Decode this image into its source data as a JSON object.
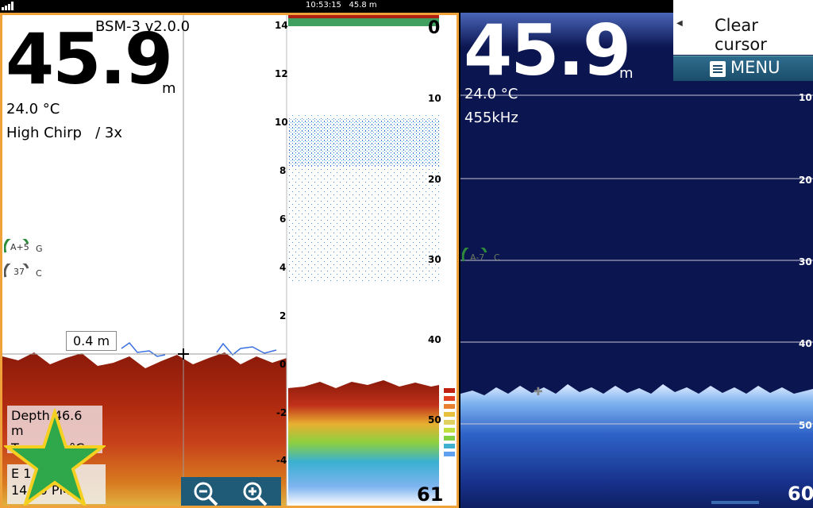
{
  "status_bar": {
    "time": "10:53:15",
    "depth": "45.8 m"
  },
  "left": {
    "title": "BSM-3 v2.0.0",
    "depth_value": "45.9",
    "depth_unit": "m",
    "temperature": "24.0 °C",
    "mode": "High Chirp",
    "zoom_level": "/ 3x",
    "gain_auto": "A+5",
    "gain_label": "G",
    "contrast_value": "37",
    "contrast_label": "C",
    "cursor_depth_label": "0.4 m",
    "info_box": {
      "depth_line": "Depth 46.6 m",
      "temp_line": "Temp 24 °C",
      "coord_line": "E 1 72'",
      "time_line": "14 , 0 PM"
    },
    "zoom_scale": [
      "14",
      "12",
      "10",
      "8",
      "6",
      "4",
      "2",
      "0",
      "-2",
      "-4"
    ],
    "depth_scale": [
      "0",
      "10",
      "20",
      "30",
      "40",
      "50",
      "61"
    ]
  },
  "right": {
    "depth_value": "45.9",
    "depth_unit": "m",
    "temperature": "24.0 °C",
    "frequency": "455kHz",
    "gain_auto": "A-7",
    "gain_label": "C",
    "depth_scale": [
      "10",
      "20",
      "30",
      "40",
      "50",
      "60"
    ]
  },
  "popup": {
    "clear_cursor": "Clear cursor",
    "menu": "MENU"
  },
  "icons": [
    "signal-icon",
    "zoom-out-icon",
    "zoom-in-icon",
    "menu-icon",
    "waypoint-star-icon",
    "cursor-cross-icon"
  ]
}
